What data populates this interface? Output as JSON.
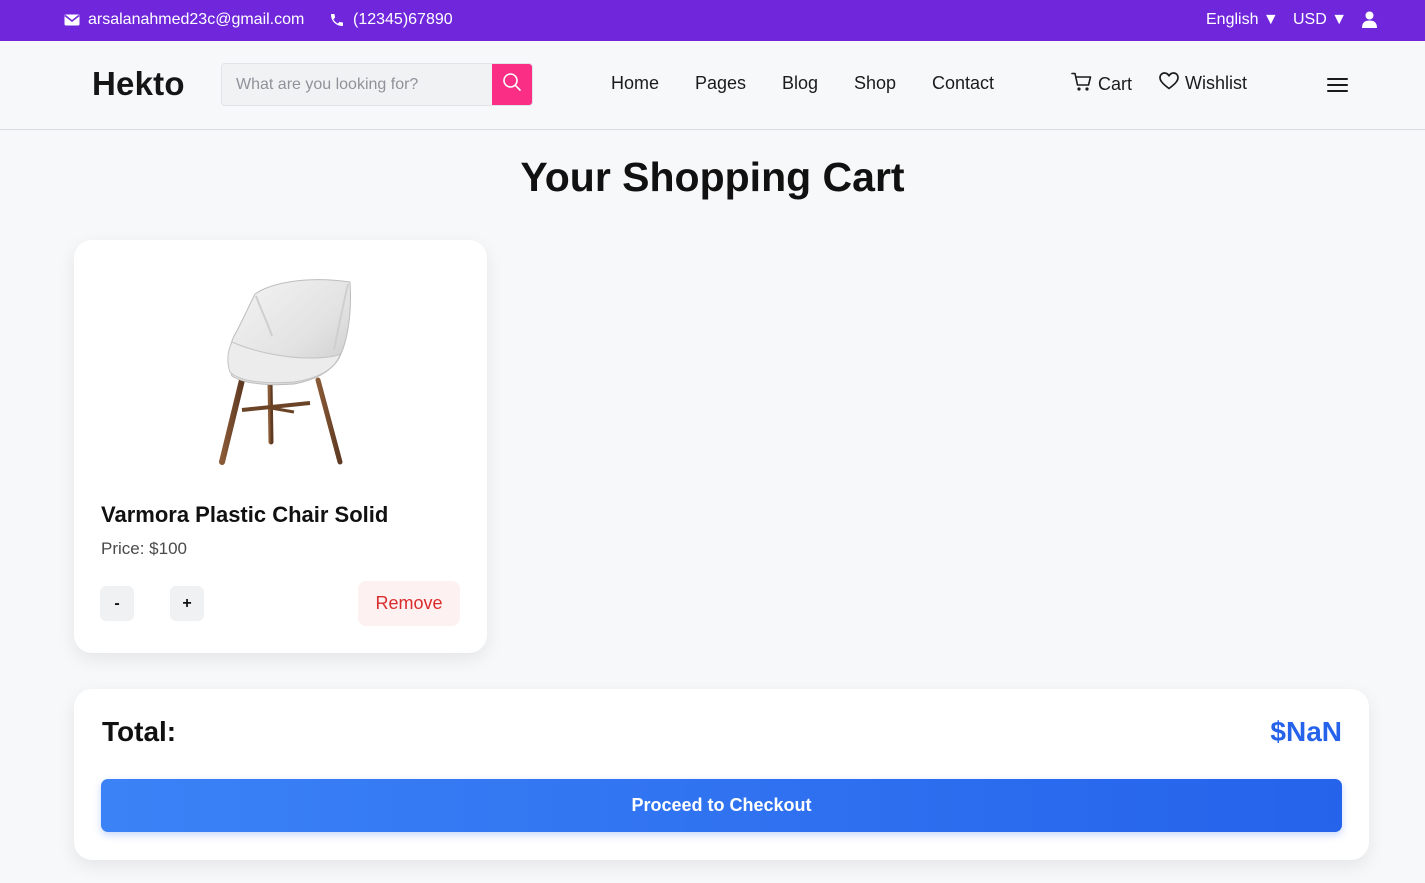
{
  "topbar": {
    "email": "arsalanahmed23c@gmail.com",
    "phone": "(12345)67890",
    "language": "English ▼",
    "currency": "USD ▼"
  },
  "header": {
    "logo": "Hekto",
    "search_placeholder": "What are you looking for?",
    "nav": [
      "Home",
      "Pages",
      "Blog",
      "Shop",
      "Contact"
    ],
    "cart_label": "Cart",
    "wishlist_label": "Wishlist"
  },
  "page": {
    "title": "Your Shopping Cart"
  },
  "cart": {
    "items": [
      {
        "name": "Varmora Plastic Chair Solid",
        "price": "Price: $100",
        "decrement": "-",
        "increment": "+",
        "remove": "Remove"
      }
    ]
  },
  "summary": {
    "total_label": "Total:",
    "total_value": "$NaN",
    "checkout_label": "Proceed to Checkout"
  },
  "colors": {
    "topbar": "#7027dc",
    "search_button": "#fb2e86",
    "total_value": "#2563eb",
    "checkout_button": "#2563eb",
    "remove_text": "#d92d2d"
  },
  "icons": [
    "mail-icon",
    "phone-icon",
    "user-icon",
    "search-icon",
    "cart-icon",
    "heart-icon",
    "hamburger-icon"
  ]
}
